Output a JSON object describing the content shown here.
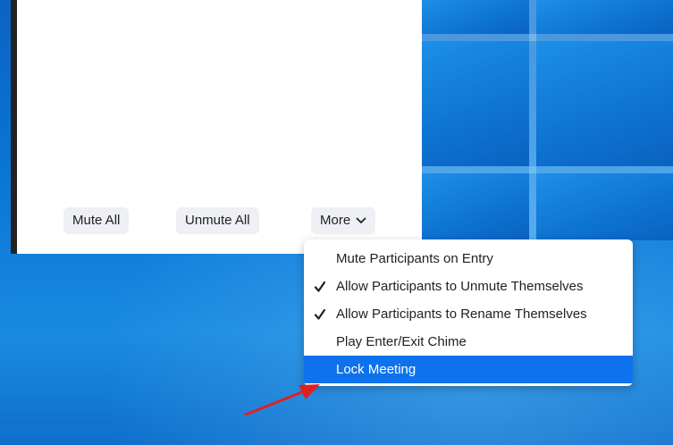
{
  "panel": {
    "buttons": {
      "mute_all": "Mute All",
      "unmute_all": "Unmute All",
      "more": "More"
    }
  },
  "menu": {
    "items": [
      {
        "label": "Mute Participants on Entry",
        "checked": false,
        "selected": false
      },
      {
        "label": "Allow Participants to Unmute Themselves",
        "checked": true,
        "selected": false
      },
      {
        "label": "Allow Participants to Rename Themselves",
        "checked": true,
        "selected": false
      },
      {
        "label": "Play Enter/Exit Chime",
        "checked": false,
        "selected": false
      },
      {
        "label": "Lock Meeting",
        "checked": false,
        "selected": true
      }
    ]
  },
  "icons": {
    "more_chevron": "chevron-down-icon",
    "check": "checkmark-icon",
    "annotation": "red-arrow-annotation"
  },
  "colors": {
    "selection": "#0e72ed",
    "annotation": "#e02020",
    "desktop": "#0a78d4"
  }
}
